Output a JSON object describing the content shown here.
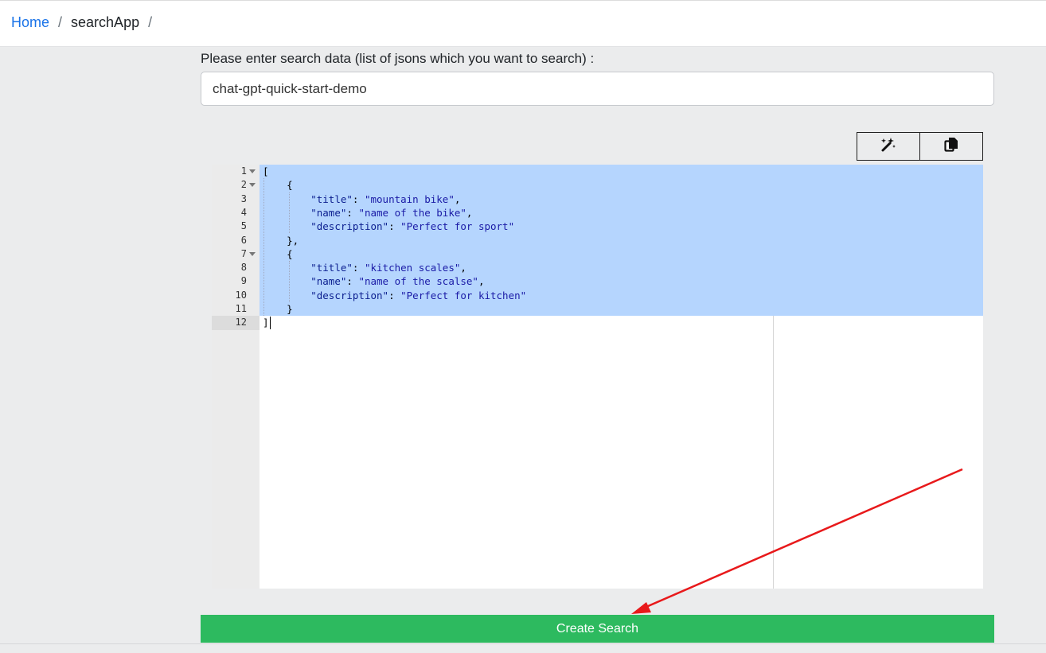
{
  "breadcrumb": {
    "home": "Home",
    "separator": "/",
    "current": "searchApp",
    "trailing_separator": "/"
  },
  "form": {
    "label": "Please enter search data (list of jsons which you want to search) :",
    "search_name_value": "chat-gpt-quick-start-demo"
  },
  "toolbar": {
    "format_icon": "magic-wand-icon",
    "copy_icon": "copy-icon"
  },
  "editor": {
    "line_numbers": [
      "1",
      "2",
      "3",
      "4",
      "5",
      "6",
      "7",
      "8",
      "9",
      "10",
      "11",
      "12"
    ],
    "active_line": "12",
    "lines": {
      "l1": "[",
      "l2": "{",
      "l3_key": "\"title\"",
      "l3_val": "\"mountain bike\"",
      "l4_key": "\"name\"",
      "l4_val": "\"name of the bike\"",
      "l5_key": "\"description\"",
      "l5_val": "\"Perfect for sport\"",
      "l6": "},",
      "l7": "{",
      "l8_key": "\"title\"",
      "l8_val": "\"kitchen scales\"",
      "l9_key": "\"name\"",
      "l9_val": "\"name of the scalse\"",
      "l10_key": "\"description\"",
      "l10_val": "\"Perfect for kitchen\"",
      "l11": "}",
      "l12": "]"
    }
  },
  "actions": {
    "create_label": "Create Search"
  },
  "colors": {
    "primary_link": "#1a73e8",
    "create_button": "#2dba5f",
    "selection": "#b5d5fe",
    "annotation_arrow": "#e8191b"
  }
}
